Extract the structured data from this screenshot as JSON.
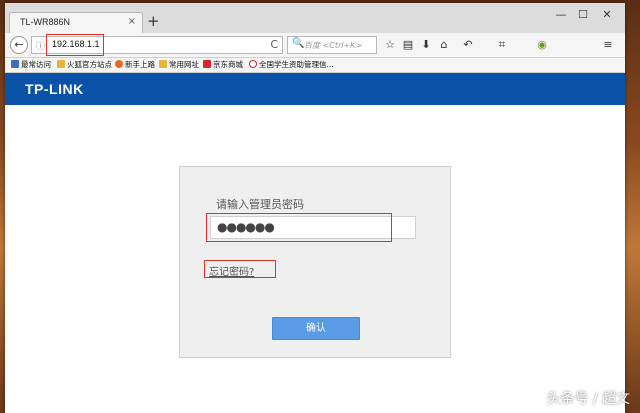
{
  "browser": {
    "tab_title": "TL-WR886N",
    "tab_close": "×",
    "new_tab": "+",
    "min": "—",
    "max": "☐",
    "close": "✕",
    "url": "192.168.1.1",
    "search_placeholder": "百度 <Ctrl+K>",
    "icons": {
      "back": "←",
      "info": "ⓘ",
      "reload": "C",
      "search": "🔍",
      "star": "☆",
      "reader": "▤",
      "download": "⬇",
      "home": "⌂",
      "undo": "↶",
      "crop": "⌗",
      "extensions": "◉",
      "menu": "≡"
    }
  },
  "bookmarks": [
    {
      "label": "最常访问",
      "color": "#3a6fc4"
    },
    {
      "label": "火狐官方站点",
      "color": "#e8b63a"
    },
    {
      "label": "新手上路",
      "color": "#e86a1a"
    },
    {
      "label": "常用网址",
      "color": "#e8b63a"
    },
    {
      "label": "京东商城",
      "color": "#d8262d"
    },
    {
      "label": "全国学生资助管理信...",
      "color": "#cc2222"
    }
  ],
  "page": {
    "logo": "TP-LINK",
    "password_label": "请输入管理员密码",
    "password_value": "●●●●●●",
    "forgot_link": "忘记密码?",
    "confirm_button": "确认"
  },
  "watermark": "头条号 / 超文",
  "colors": {
    "brand_bar": "#0a52a7",
    "confirm_button": "#5a9be6",
    "highlight": "#e0302a"
  }
}
